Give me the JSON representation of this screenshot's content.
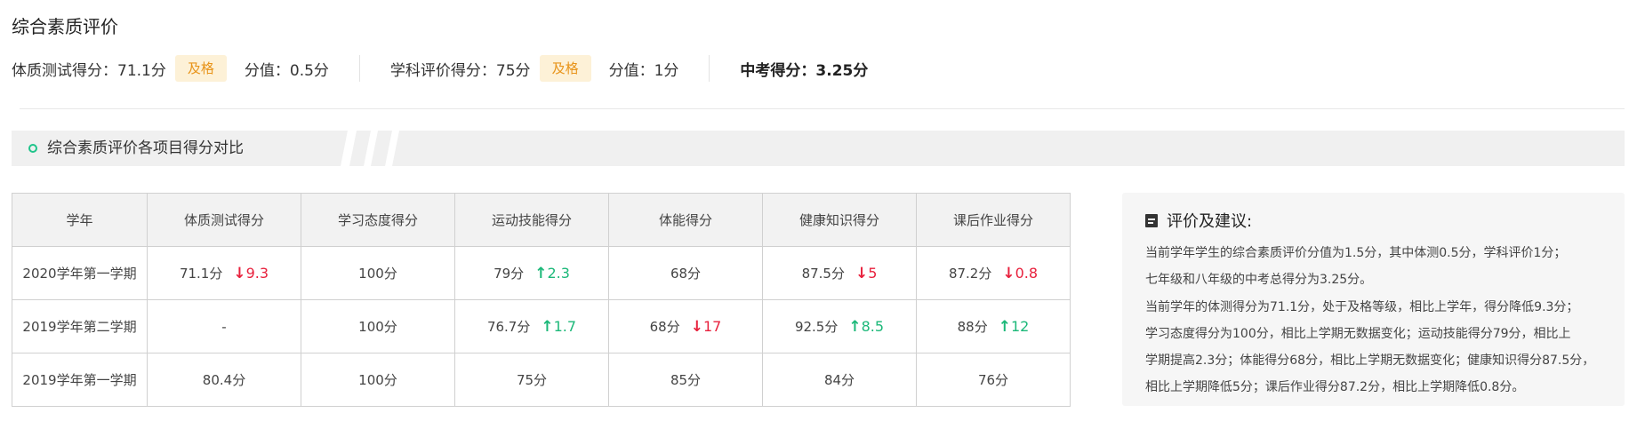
{
  "page_title": "综合素质评价",
  "summary": {
    "physical_label": "体质测试得分：",
    "physical_value": "71.1分",
    "physical_badge": "及格",
    "physical_weight": "分值：0.5分",
    "subject_label": "学科评价得分：",
    "subject_value": "75分",
    "subject_badge": "及格",
    "subject_weight": "分值：1分",
    "exam_label": "中考得分：",
    "exam_value": "3.25分"
  },
  "section": {
    "title": "综合素质评价各项目得分对比"
  },
  "table": {
    "headers": [
      "学年",
      "体质测试得分",
      "学习态度得分",
      "运动技能得分",
      "体能得分",
      "健康知识得分",
      "课后作业得分"
    ],
    "rows": [
      {
        "year": "2020学年第一学期",
        "cells": [
          {
            "value": "71.1分",
            "delta": "9.3",
            "dir": "down"
          },
          {
            "value": "100分",
            "delta": "",
            "dir": ""
          },
          {
            "value": "79分",
            "delta": "2.3",
            "dir": "up"
          },
          {
            "value": "68分",
            "delta": "",
            "dir": ""
          },
          {
            "value": "87.5分",
            "delta": "5",
            "dir": "down"
          },
          {
            "value": "87.2分",
            "delta": "0.8",
            "dir": "down"
          }
        ]
      },
      {
        "year": "2019学年第二学期",
        "cells": [
          {
            "value": "-",
            "delta": "",
            "dir": ""
          },
          {
            "value": "100分",
            "delta": "",
            "dir": ""
          },
          {
            "value": "76.7分",
            "delta": "1.7",
            "dir": "up"
          },
          {
            "value": "68分",
            "delta": "17",
            "dir": "down"
          },
          {
            "value": "92.5分",
            "delta": "8.5",
            "dir": "up"
          },
          {
            "value": "88分",
            "delta": "12",
            "dir": "up"
          }
        ]
      },
      {
        "year": "2019学年第一学期",
        "cells": [
          {
            "value": "80.4分",
            "delta": "",
            "dir": ""
          },
          {
            "value": "100分",
            "delta": "",
            "dir": ""
          },
          {
            "value": "75分",
            "delta": "",
            "dir": ""
          },
          {
            "value": "85分",
            "delta": "",
            "dir": ""
          },
          {
            "value": "84分",
            "delta": "",
            "dir": ""
          },
          {
            "value": "76分",
            "delta": "",
            "dir": ""
          }
        ]
      }
    ]
  },
  "advice": {
    "title": "评价及建议:",
    "icon": "document-icon",
    "lines": [
      "当前学年学生的综合素质评价分值为1.5分，其中体测0.5分，学科评价1分；",
      "七年级和八年级的中考总得分为3.25分。",
      "当前学年的体测得分为71.1分，处于及格等级，相比上学年，得分降低9.3分；",
      "学习态度得分为100分，相比上学期无数据变化；运动技能得分79分，相比上",
      "学期提高2.3分；体能得分68分，相比上学期无数据变化；健康知识得分87.5分，",
      "相比上学期降低5分；课后作业得分87.2分，相比上学期降低0.8分。"
    ]
  },
  "colors": {
    "badge_bg": "#fdf1d7",
    "badge_text": "#e8941a",
    "up": "#1cb879",
    "down": "#e8213d",
    "accent_dot": "#1ec48a"
  }
}
